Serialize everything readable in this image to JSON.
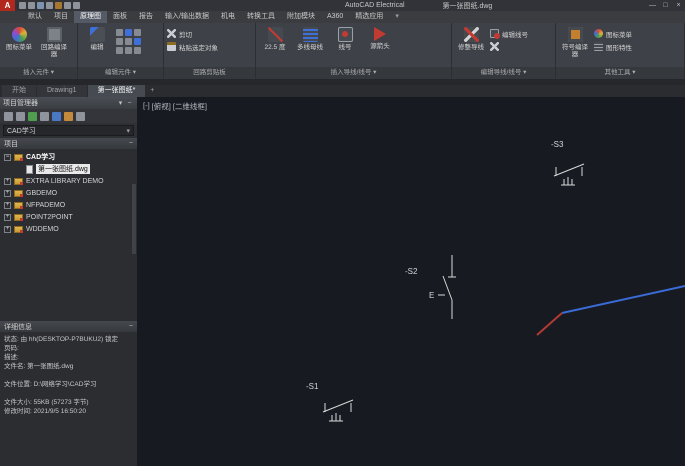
{
  "window": {
    "app_title": "AutoCAD Electrical",
    "doc_title": "第一张图纸.dwg",
    "minimize": "—",
    "maximize": "□",
    "close": "×"
  },
  "ribbon": {
    "tabs": [
      "默认",
      "项目",
      "原理图",
      "面板",
      "报告",
      "输入/输出数据",
      "机电",
      "转换工具",
      "附加模块",
      "A360",
      "精选应用"
    ],
    "panels": [
      {
        "caption": "插入元件 ▾",
        "buttons": [
          "图标菜单",
          "回路编译器"
        ]
      },
      {
        "caption": "编辑元件 ▾",
        "buttons": [
          "编辑"
        ]
      },
      {
        "caption": "回路剪贴板",
        "buttons": [
          "剪切",
          "粘贴选定对象"
        ]
      },
      {
        "caption": "插入导线/线号 ▾",
        "buttons": [
          "22.5 度",
          "多线母线",
          "线号",
          "源箭头"
        ]
      },
      {
        "caption": "编辑导线/线号 ▾",
        "buttons": [
          "修整导线",
          "编辑线号"
        ]
      },
      {
        "caption": "其他工具 ▾",
        "buttons": [
          "符号编译器",
          "图标菜单",
          "图形特性"
        ]
      }
    ]
  },
  "doc_tabs": {
    "tabs": [
      "开始",
      "Drawing1",
      "第一张图纸*"
    ],
    "add": "+"
  },
  "project_manager": {
    "title": "项目管理器",
    "dropdown_value": "CAD学习",
    "dropdown_arrow": "▾",
    "projects_header": "项目",
    "details_header": "详细信息",
    "collapse_glyph": "−",
    "tree": [
      {
        "exp": "−",
        "label": "CAD学习"
      },
      {
        "exp": "",
        "label": "第一张图纸.dwg"
      },
      {
        "exp": "+",
        "label": "EXTRA LIBRARY DEMO"
      },
      {
        "exp": "+",
        "label": "GBDEMO"
      },
      {
        "exp": "+",
        "label": "NFPADEMO"
      },
      {
        "exp": "+",
        "label": "POINT2POINT"
      },
      {
        "exp": "+",
        "label": "WDDEMO"
      }
    ],
    "details_lines": [
      "状态: 由 hh(DESKTOP-P7BUKU2) 锁定",
      "页码:",
      "描述:",
      "文件名: 第一张图纸.dwg",
      "",
      "文件位置: D:\\网络学习\\CAD学习",
      "",
      "文件大小: 55KB (57273 字节)",
      "修改时间: 2021/9/5 16:50:20"
    ]
  },
  "canvas": {
    "viewport_controls": [
      "[-]",
      "[俯视]",
      "[二维线框]"
    ],
    "labels": {
      "s1": "-S1",
      "s2": "-S2",
      "s3": "-S3",
      "e_mark": "E"
    },
    "colors": {
      "background": "#171a21",
      "wire_blue": "#3a6bd6",
      "wire_red": "#b23a32",
      "entity": "#d9d9d9"
    }
  }
}
